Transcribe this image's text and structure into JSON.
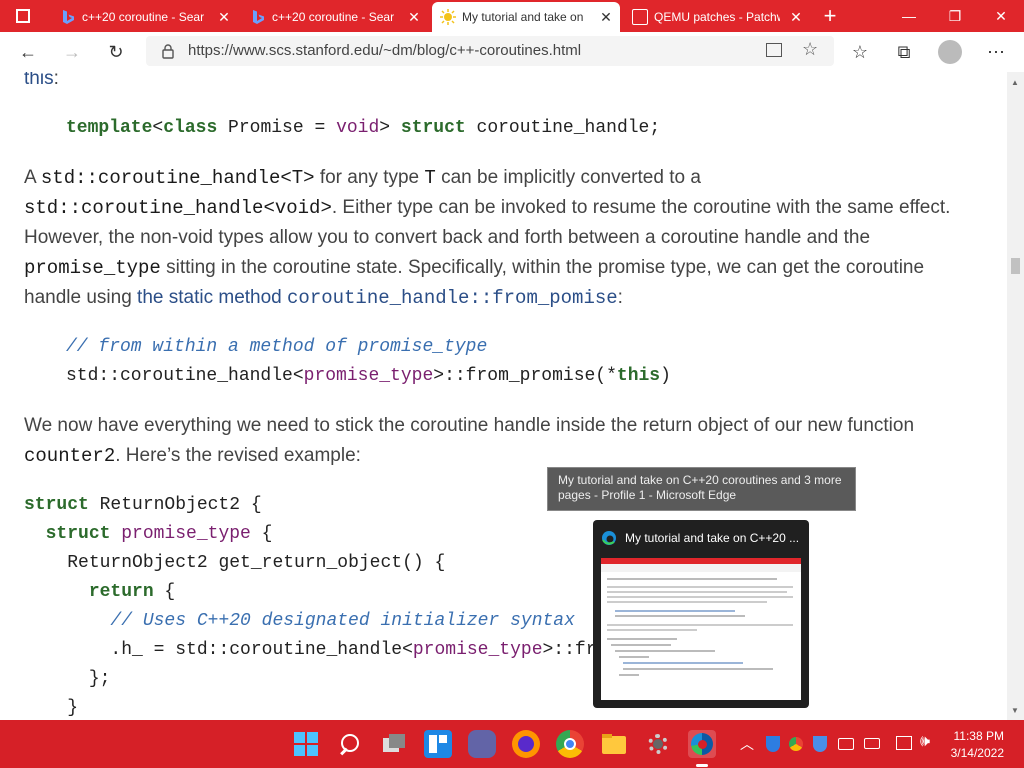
{
  "browser": {
    "tabs": [
      {
        "label": "c++20 coroutine - Sear",
        "close": "✕"
      },
      {
        "label": "c++20 coroutine - Sear",
        "close": "✕"
      },
      {
        "label": "My tutorial and take on",
        "close": "✕"
      },
      {
        "label": "QEMU patches - Patchw",
        "close": "✕"
      }
    ],
    "new_tab": "+",
    "url": "https://www.scs.stanford.edu/~dm/blog/c++-coroutines.html",
    "colors": {
      "accent": "#e0262b",
      "taskbar": "#d62027"
    }
  },
  "article": {
    "lead": "this",
    "lead_colon": ":",
    "code1": {
      "kw1": "template",
      "t1": "<",
      "kw2": "class",
      "t2": " Promise = ",
      "ty1": "void",
      "t3": "> ",
      "kw3": "struct",
      "t4": " coroutine_handle;"
    },
    "para1": {
      "a": "A ",
      "b": "std::coroutine_handle<T>",
      "c": " for any type ",
      "d": "T",
      "e": " can be implicitly converted to a",
      "f": "std::coroutine_handle<void>",
      "g": ". Either type can be invoked to resume the coroutine with the same effect.",
      "h": "However, the non-void types allow you to convert back and forth between a coroutine handle and the",
      "i": "promise_type",
      "j": " sitting in the coroutine state. Specifically, within the promise type, we can get the coroutine",
      "k": "handle using ",
      "l": "the static method ",
      "m": "coroutine_handle::from_pomise",
      "n": ":"
    },
    "code2": {
      "comment": "// from within a method of promise_type",
      "a": "std::coroutine_handle<",
      "b": "promise_type",
      "c": ">::from_promise(*",
      "d": "this",
      "e": ")"
    },
    "para2": {
      "a": "We now have everything we need to stick the coroutine handle inside the return object of our new function",
      "b": "counter2",
      "c": ". Here’s the revised example:"
    },
    "code3": {
      "l1a": "struct",
      "l1b": " ReturnObject2 {",
      "l2a": "struct",
      "l2b": " promise_type",
      "l2c": " {",
      "l3": "ReturnObject2 get_return_object() {",
      "l4": "return",
      "l4b": " {",
      "l5": "// Uses C++20 designated initializer syntax",
      "l6a": ".h_ = std::coroutine_handle<",
      "l6b": "promise_type",
      "l6c": ">::fro",
      "l7": "};",
      "l8": "}"
    }
  },
  "tooltip": {
    "text": "My tutorial and take on C++20 coroutines and 3 more pages - Profile 1 - Microsoft Edge"
  },
  "preview": {
    "title": "My tutorial and take on C++20 ..."
  },
  "taskbar": {
    "time": "11:38 PM",
    "date": "3/14/2022"
  }
}
